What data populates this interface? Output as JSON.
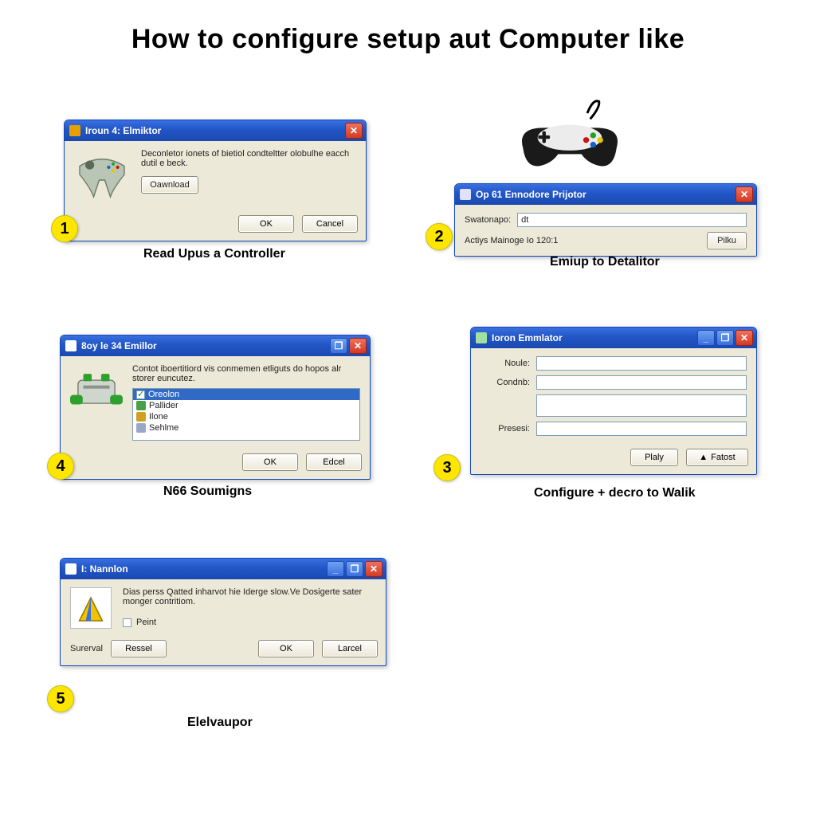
{
  "title": "How to configure setup aut Computer like",
  "steps": {
    "s1": {
      "num": "1",
      "caption": "Read Upus a Controller",
      "win_title": "Iroun 4: Elmiktor",
      "desc": "Deconletor ionets of bietiol condteltter olobulhe eacch dutil e beck.",
      "download_btn": "Oawnload",
      "ok": "OK",
      "cancel": "Cancel"
    },
    "s2": {
      "num": "2",
      "caption": "Emiup to Detalitor",
      "win_title": "Op 61 Ennodore Prijotor",
      "row1_label": "Swatonapo:",
      "row1_value": "dt",
      "row2_text": "Actiys Mainoge Io 120:1",
      "btn": "Pilku"
    },
    "s3": {
      "num": "3",
      "caption": "Configure + decro to Walik",
      "win_title": "Ioron Emmlator",
      "label1": "Noule:",
      "label2": "Condnb:",
      "label3": "Presesi:",
      "btn_play": "Plaly",
      "btn_fatest": "Fatost",
      "arrow_glyph": "▲"
    },
    "s4": {
      "num": "4",
      "caption": "N66 Soumigns",
      "win_title": "8oy le 34 Emillor",
      "desc": "Contot iboertitiord vis conmemen etliguts do hopos alr storer euncutez.",
      "list": [
        "Oreolon",
        "Pallider",
        "Ilone",
        "Sehlme"
      ],
      "ok": "OK",
      "edit": "Edcel"
    },
    "s5": {
      "num": "5",
      "caption": "Elelvaupor",
      "win_title": "I: Nannlon",
      "desc": "Dias perss Qatted inharvot hie Iderge slow.Ve Dosigerte sater monger contritiom.",
      "checkbox_label": "Peint",
      "left_label": "Surerval",
      "btn_reset": "Ressel",
      "ok": "OK",
      "cancel": "Larcel"
    }
  }
}
